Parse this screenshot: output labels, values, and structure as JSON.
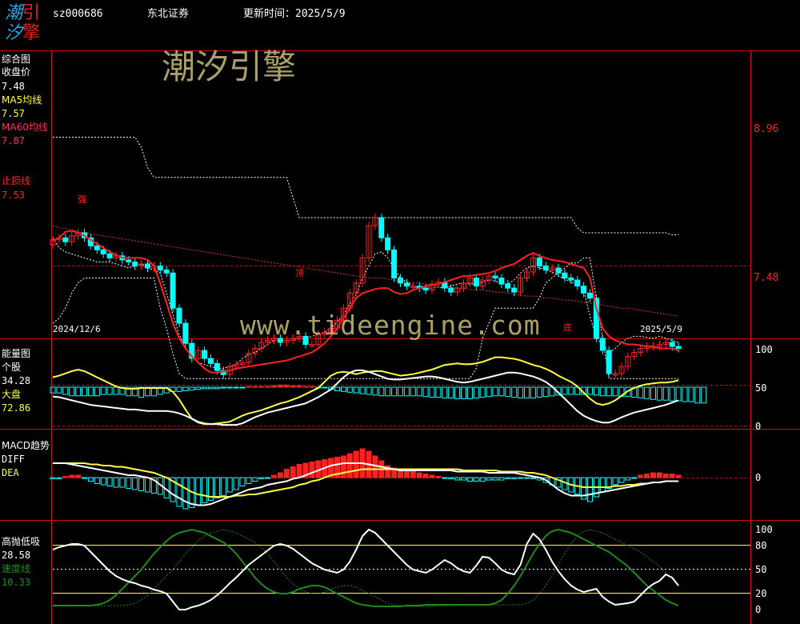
{
  "header": {
    "logo_chars": [
      "潮",
      "引",
      "汐",
      "擎"
    ],
    "code": "sz000686",
    "name": "东北证券",
    "update_label": "更新时间：",
    "update_value": "2025/5/9"
  },
  "watermark": {
    "brand": "潮汐引擎",
    "url": "www.tideengine.com"
  },
  "colors": {
    "up": "#ff2020",
    "down": "#00ffff",
    "ma5": "#ffff40",
    "ma60": "#ff3060",
    "stop": "#ff2020",
    "green": "#1a8c1a",
    "axis": "#d01010"
  },
  "panel1": {
    "labels": {
      "title": "综合图",
      "close_label": "收盘价",
      "close_value": "7.48",
      "ma5_label": "MA5均线",
      "ma5_value": "7.57",
      "ma60_label": "MA60均线",
      "ma60_value": "7.87",
      "stop_label": "止损线",
      "stop_value": "7.53"
    },
    "axis_ticks": [
      "8.96",
      "7.48"
    ],
    "date_start": "2024/12/6",
    "date_end": "2025/5/9",
    "marks": [
      "强",
      "顶",
      "底"
    ]
  },
  "panel2": {
    "labels": {
      "title": "能量图",
      "stock_label": "个股",
      "stock_value": "34.28",
      "market_label": "大盘",
      "market_value": "72.86"
    },
    "axis_ticks": [
      "100",
      "50",
      "0"
    ]
  },
  "panel3": {
    "labels": {
      "title": "MACD趋势",
      "diff_label": "DIFF",
      "dea_label": "DEA"
    },
    "axis_ticks": [
      "0"
    ]
  },
  "panel4": {
    "labels": {
      "title": "高抛低吸",
      "value": "28.58",
      "speed_label": "速度线",
      "speed_value": "10.33"
    },
    "axis_ticks": [
      "100",
      "80",
      "50",
      "20",
      "0"
    ]
  },
  "chart_data": {
    "type": "candlestick",
    "n": 100,
    "close": [
      7.88,
      7.9,
      7.86,
      7.92,
      7.95,
      7.9,
      7.82,
      7.78,
      7.74,
      7.7,
      7.72,
      7.68,
      7.66,
      7.62,
      7.64,
      7.6,
      7.62,
      7.58,
      7.55,
      7.2,
      7.05,
      6.85,
      6.7,
      6.78,
      6.7,
      6.65,
      6.58,
      6.54,
      6.62,
      6.64,
      6.66,
      6.75,
      6.8,
      6.86,
      6.88,
      6.9,
      6.86,
      6.88,
      6.9,
      6.92,
      6.84,
      6.84,
      6.94,
      6.96,
      7.0,
      7.08,
      7.2,
      7.35,
      7.45,
      7.7,
      8.02,
      8.1,
      7.9,
      7.78,
      7.5,
      7.45,
      7.42,
      7.42,
      7.4,
      7.38,
      7.44,
      7.46,
      7.4,
      7.36,
      7.4,
      7.45,
      7.5,
      7.42,
      7.48,
      7.52,
      7.5,
      7.44,
      7.4,
      7.36,
      7.5,
      7.56,
      7.7,
      7.62,
      7.58,
      7.6,
      7.55,
      7.5,
      7.48,
      7.42,
      7.35,
      7.3,
      6.9,
      6.78,
      6.55,
      6.55,
      6.62,
      6.72,
      6.76,
      6.8,
      6.82,
      6.82,
      6.84,
      6.86,
      6.82,
      6.8
    ],
    "ma5": [
      7.9,
      7.8,
      7.76,
      7.74,
      7.72,
      7.7,
      7.68,
      7.66,
      7.66,
      7.66,
      7.64,
      7.62,
      7.6,
      7.62,
      7.64,
      7.6,
      7.58,
      7.55,
      7.35,
      7.14,
      6.94,
      6.8,
      6.72,
      6.66,
      6.64,
      6.62,
      6.6,
      6.6,
      6.62,
      6.64,
      6.7,
      6.74,
      6.76,
      6.8,
      6.84,
      6.88,
      6.88,
      6.88,
      6.88,
      6.9,
      6.9,
      6.92,
      6.94,
      6.96,
      7.0,
      7.06,
      7.14,
      7.24,
      7.34,
      7.5,
      7.62,
      7.74,
      7.76,
      7.7,
      7.6,
      7.5,
      7.46,
      7.42,
      7.4,
      7.4,
      7.4,
      7.41,
      7.4,
      7.42,
      7.44,
      7.45,
      7.44,
      7.44,
      7.46,
      7.48,
      7.47,
      7.45,
      7.44,
      7.48,
      7.55,
      7.6,
      7.62,
      7.6,
      7.58,
      7.56,
      7.52,
      7.49,
      7.46,
      7.44,
      7.38,
      7.12,
      6.9,
      6.84,
      6.76,
      6.8,
      6.86,
      6.9,
      6.92,
      6.92,
      6.91,
      6.9,
      6.92,
      6.9,
      6.88,
      6.86
    ],
    "ma60": [
      8.02,
      8.0,
      7.99,
      7.98,
      7.96,
      7.95,
      7.94,
      7.93,
      7.92,
      7.91,
      7.9,
      7.89,
      7.88,
      7.87,
      7.86,
      7.85,
      7.84,
      7.83,
      7.82,
      7.81,
      7.8,
      7.79,
      7.78,
      7.77,
      7.76,
      7.75,
      7.74,
      7.73,
      7.72,
      7.71,
      7.7,
      7.69,
      7.68,
      7.67,
      7.66,
      7.65,
      7.64,
      7.63,
      7.62,
      7.61,
      7.6,
      7.59,
      7.58,
      7.57,
      7.56,
      7.55,
      7.54,
      7.53,
      7.52,
      7.51,
      7.5,
      7.5,
      7.5,
      7.49,
      7.48,
      7.47,
      7.46,
      7.45,
      7.45,
      7.44,
      7.43,
      7.42,
      7.42,
      7.41,
      7.4,
      7.39,
      7.39,
      7.38,
      7.38,
      7.37,
      7.36,
      7.36,
      7.35,
      7.34,
      7.33,
      7.32,
      7.32,
      7.31,
      7.3,
      7.3,
      7.29,
      7.28,
      7.28,
      7.27,
      7.26,
      7.25,
      7.24,
      7.23,
      7.22,
      7.21,
      7.2,
      7.2,
      7.19,
      7.18,
      7.17,
      7.16,
      7.15,
      7.14,
      7.13,
      7.12
    ],
    "stop": [
      7.87,
      7.9,
      7.96,
      7.97,
      7.95,
      7.92,
      7.88,
      7.84,
      7.8,
      7.76,
      7.73,
      7.7,
      7.7,
      7.7,
      7.7,
      7.68,
      7.62,
      7.45,
      7.25,
      7.05,
      6.9,
      6.8,
      6.72,
      6.66,
      6.6,
      6.56,
      6.56,
      6.57,
      6.58,
      6.6,
      6.61,
      6.62,
      6.63,
      6.64,
      6.65,
      6.66,
      6.67,
      6.68,
      6.7,
      6.72,
      6.74,
      6.76,
      6.8,
      6.85,
      6.92,
      7.0,
      7.1,
      7.2,
      7.3,
      7.35,
      7.37,
      7.39,
      7.4,
      7.4,
      7.36,
      7.34,
      7.35,
      7.38,
      7.4,
      7.42,
      7.43,
      7.44,
      7.46,
      7.48,
      7.5,
      7.52,
      7.52,
      7.53,
      7.54,
      7.55,
      7.57,
      7.6,
      7.62,
      7.64,
      7.68,
      7.72,
      7.75,
      7.72,
      7.7,
      7.68,
      7.67,
      7.66,
      7.64,
      7.62,
      7.6,
      7.5,
      7.2,
      7.0,
      6.92,
      6.88,
      6.86,
      6.84,
      6.84,
      6.83,
      6.82,
      6.82,
      6.8,
      6.8,
      6.8,
      6.78
    ],
    "upper_band": [
      8.9,
      8.9,
      8.9,
      8.9,
      8.9,
      8.9,
      8.9,
      8.9,
      8.9,
      8.9,
      8.9,
      8.9,
      8.9,
      8.9,
      8.8,
      8.6,
      8.5,
      8.5,
      8.5,
      8.5,
      8.5,
      8.5,
      8.5,
      8.5,
      8.5,
      8.5,
      8.5,
      8.5,
      8.5,
      8.5,
      8.5,
      8.5,
      8.5,
      8.5,
      8.5,
      8.5,
      8.5,
      8.5,
      8.3,
      8.1,
      8.1,
      8.1,
      8.1,
      8.1,
      8.1,
      8.1,
      8.1,
      8.1,
      8.1,
      8.1,
      8.1,
      8.1,
      8.1,
      8.1,
      8.1,
      8.1,
      8.1,
      8.1,
      8.1,
      8.1,
      8.1,
      8.1,
      8.1,
      8.1,
      8.1,
      8.1,
      8.1,
      8.1,
      8.1,
      8.1,
      8.1,
      8.1,
      8.1,
      8.1,
      8.1,
      8.1,
      8.1,
      8.1,
      8.1,
      8.1,
      8.1,
      8.1,
      8.1,
      8.0,
      7.95,
      7.95,
      7.95,
      7.95,
      7.95,
      7.95,
      7.95,
      7.95,
      7.95,
      7.95,
      7.95,
      7.95,
      7.95,
      7.95,
      7.93,
      7.93
    ],
    "lower_band": [
      7.05,
      7.1,
      7.2,
      7.35,
      7.45,
      7.5,
      7.5,
      7.5,
      7.5,
      7.5,
      7.5,
      7.5,
      7.5,
      7.5,
      7.5,
      7.5,
      7.5,
      7.2,
      7.0,
      6.75,
      6.55,
      6.5,
      6.5,
      6.5,
      6.5,
      6.5,
      6.5,
      6.5,
      6.5,
      6.5,
      6.5,
      6.5,
      6.5,
      6.5,
      6.5,
      6.5,
      6.5,
      6.5,
      6.5,
      6.5,
      6.5,
      6.5,
      6.5,
      6.5,
      6.5,
      6.5,
      6.5,
      6.5,
      6.5,
      6.5,
      6.5,
      6.5,
      6.5,
      6.5,
      6.5,
      6.5,
      6.5,
      6.5,
      6.5,
      6.5,
      6.5,
      6.5,
      6.5,
      6.5,
      6.5,
      6.5,
      6.5,
      6.6,
      6.9,
      7.05,
      7.2,
      7.2,
      7.2,
      7.2,
      7.2,
      7.2,
      7.2,
      7.3,
      7.45,
      7.5,
      7.55,
      7.6,
      7.65,
      7.65,
      7.7,
      7.7,
      7.3,
      6.9,
      6.5,
      6.5,
      6.5,
      6.5,
      6.5,
      6.5,
      6.5,
      6.5,
      6.5,
      6.5,
      6.5,
      6.5
    ],
    "energy_stock": [
      39,
      38,
      36,
      34,
      32,
      30,
      28,
      27,
      26,
      25,
      24,
      23,
      22,
      22,
      21,
      20,
      20,
      20,
      20,
      19,
      17,
      14,
      10,
      6,
      4,
      3,
      3,
      2,
      2,
      2,
      4,
      8,
      12,
      15,
      18,
      20,
      22,
      24,
      26,
      28,
      30,
      34,
      38,
      43,
      48,
      56,
      64,
      70,
      73,
      73,
      71,
      68,
      65,
      62,
      61,
      61,
      62,
      63,
      64,
      65,
      65,
      64,
      62,
      60,
      58,
      57,
      58,
      60,
      62,
      64,
      66,
      68,
      70,
      70,
      69,
      67,
      65,
      62,
      58,
      52,
      44,
      36,
      28,
      20,
      14,
      10,
      7,
      5,
      5,
      8,
      12,
      15,
      18,
      20,
      22,
      24,
      26,
      28,
      31,
      34
    ],
    "energy_market": [
      64,
      66,
      69,
      72,
      74,
      72,
      68,
      64,
      60,
      56,
      52,
      50,
      49,
      49,
      50,
      50,
      50,
      50,
      50,
      45,
      35,
      22,
      10,
      5,
      3,
      3,
      4,
      5,
      6,
      10,
      14,
      17,
      19,
      21,
      24,
      27,
      30,
      32,
      35,
      38,
      42,
      46,
      50,
      58,
      66,
      70,
      71,
      70,
      68,
      70,
      71,
      72,
      72,
      70,
      68,
      66,
      67,
      68,
      70,
      72,
      74,
      77,
      80,
      81,
      82,
      81,
      81,
      82,
      84,
      87,
      90,
      90,
      89,
      88,
      86,
      83,
      80,
      78,
      75,
      71,
      66,
      62,
      58,
      52,
      44,
      36,
      30,
      28,
      30,
      34,
      40,
      46,
      50,
      53,
      55,
      56,
      57,
      57,
      58,
      60
    ],
    "energy_hist": [
      -8,
      -8,
      -10,
      -12,
      -12,
      -12,
      -12,
      -12,
      -10,
      -10,
      -10,
      -10,
      -12,
      -12,
      -14,
      -12,
      -12,
      -10,
      -8,
      -6,
      -6,
      -5,
      -4,
      -3,
      -2,
      -2,
      -2,
      -1,
      0,
      0,
      0,
      1,
      1,
      1,
      1,
      2,
      3,
      3,
      2,
      2,
      1,
      1,
      0,
      -1,
      -3,
      -5,
      -6,
      -7,
      -8,
      -9,
      -10,
      -11,
      -12,
      -12,
      -12,
      -12,
      -12,
      -12,
      -12,
      -13,
      -14,
      -14,
      -15,
      -15,
      -16,
      -16,
      -16,
      -15,
      -14,
      -13,
      -12,
      -12,
      -13,
      -14,
      -15,
      -15,
      -15,
      -14,
      -13,
      -12,
      -11,
      -10,
      -10,
      -10,
      -10,
      -10,
      -11,
      -12,
      -12,
      -12,
      -13,
      -13,
      -14,
      -15,
      -16,
      -17,
      -18,
      -18,
      -19,
      -19,
      -20,
      -20,
      -22,
      -22
    ],
    "macd_dif": [
      0.12,
      0.12,
      0.12,
      0.11,
      0.1,
      0.09,
      0.08,
      0.07,
      0.06,
      0.05,
      0.04,
      0.03,
      0.02,
      0.02,
      0.01,
      0.0,
      -0.02,
      -0.06,
      -0.1,
      -0.14,
      -0.17,
      -0.2,
      -0.22,
      -0.23,
      -0.23,
      -0.22,
      -0.2,
      -0.18,
      -0.16,
      -0.14,
      -0.12,
      -0.1,
      -0.09,
      -0.08,
      -0.06,
      -0.05,
      -0.04,
      -0.03,
      -0.01,
      0.0,
      0.02,
      0.04,
      0.06,
      0.08,
      0.1,
      0.11,
      0.12,
      0.12,
      0.12,
      0.12,
      0.11,
      0.1,
      0.09,
      0.08,
      0.07,
      0.06,
      0.06,
      0.06,
      0.06,
      0.06,
      0.06,
      0.06,
      0.06,
      0.06,
      0.05,
      0.05,
      0.05,
      0.05,
      0.05,
      0.04,
      0.04,
      0.04,
      0.04,
      0.04,
      0.03,
      0.02,
      0.01,
      0.0,
      -0.02,
      -0.06,
      -0.1,
      -0.13,
      -0.15,
      -0.15,
      -0.15,
      -0.14,
      -0.13,
      -0.12,
      -0.11,
      -0.1,
      -0.09,
      -0.08,
      -0.07,
      -0.06,
      -0.05,
      -0.04,
      -0.04,
      -0.03,
      -0.03,
      -0.03
    ],
    "macd_dea": [
      0.12,
      0.12,
      0.12,
      0.12,
      0.12,
      0.12,
      0.11,
      0.11,
      0.1,
      0.1,
      0.09,
      0.09,
      0.08,
      0.07,
      0.06,
      0.05,
      0.04,
      0.02,
      0.0,
      -0.03,
      -0.06,
      -0.09,
      -0.12,
      -0.14,
      -0.15,
      -0.16,
      -0.16,
      -0.16,
      -0.16,
      -0.15,
      -0.15,
      -0.14,
      -0.14,
      -0.13,
      -0.12,
      -0.11,
      -0.1,
      -0.09,
      -0.08,
      -0.06,
      -0.05,
      -0.03,
      -0.02,
      0.0,
      0.02,
      0.03,
      0.04,
      0.05,
      0.06,
      0.07,
      0.07,
      0.07,
      0.07,
      0.07,
      0.07,
      0.07,
      0.07,
      0.07,
      0.07,
      0.07,
      0.07,
      0.07,
      0.07,
      0.07,
      0.07,
      0.06,
      0.06,
      0.06,
      0.06,
      0.06,
      0.06,
      0.05,
      0.05,
      0.05,
      0.05,
      0.04,
      0.04,
      0.03,
      0.02,
      0.0,
      -0.02,
      -0.04,
      -0.06,
      -0.07,
      -0.08,
      -0.08,
      -0.08,
      -0.08,
      -0.08,
      -0.07,
      -0.07,
      -0.06,
      -0.06,
      -0.05,
      -0.05,
      -0.04,
      -0.04,
      -0.03,
      -0.03,
      -0.03
    ],
    "macd_hist": [
      -0.01,
      -0.01,
      0.01,
      0.02,
      0.02,
      0.0,
      -0.03,
      -0.05,
      -0.06,
      -0.07,
      -0.08,
      -0.08,
      -0.09,
      -0.1,
      -0.11,
      -0.12,
      -0.13,
      -0.14,
      -0.17,
      -0.2,
      -0.24,
      -0.26,
      -0.25,
      -0.23,
      -0.21,
      -0.19,
      -0.17,
      -0.15,
      -0.12,
      -0.1,
      -0.07,
      -0.05,
      -0.03,
      -0.01,
      0.0,
      0.02,
      0.04,
      0.07,
      0.09,
      0.11,
      0.12,
      0.13,
      0.14,
      0.15,
      0.16,
      0.17,
      0.18,
      0.2,
      0.22,
      0.24,
      0.22,
      0.18,
      0.14,
      0.1,
      0.08,
      0.06,
      0.05,
      0.05,
      0.04,
      0.03,
      0.02,
      0.01,
      0.0,
      -0.01,
      -0.02,
      -0.02,
      -0.03,
      -0.03,
      -0.03,
      -0.02,
      -0.02,
      -0.02,
      -0.01,
      -0.01,
      0.0,
      0.0,
      -0.01,
      -0.02,
      -0.04,
      -0.06,
      -0.08,
      -0.1,
      -0.12,
      -0.14,
      -0.18,
      -0.2,
      -0.16,
      -0.12,
      -0.09,
      -0.06,
      -0.04,
      -0.02,
      0.0,
      0.02,
      0.03,
      0.04,
      0.04,
      0.03,
      0.03,
      0.02
    ],
    "hilo_white": [
      75,
      78,
      80,
      82,
      82,
      80,
      72,
      64,
      56,
      48,
      42,
      38,
      35,
      33,
      30,
      28,
      25,
      23,
      20,
      10,
      0,
      0,
      3,
      5,
      8,
      12,
      18,
      25,
      33,
      40,
      48,
      56,
      62,
      68,
      74,
      80,
      82,
      80,
      76,
      70,
      64,
      58,
      54,
      50,
      48,
      46,
      50,
      60,
      75,
      92,
      100,
      96,
      88,
      80,
      72,
      64,
      56,
      50,
      48,
      46,
      50,
      56,
      62,
      58,
      52,
      48,
      46,
      55,
      66,
      65,
      58,
      50,
      46,
      44,
      56,
      82,
      95,
      88,
      75,
      60,
      48,
      38,
      30,
      25,
      22,
      24,
      26,
      16,
      10,
      6,
      7,
      8,
      10,
      18,
      26,
      32,
      36,
      44,
      40,
      30
    ],
    "hilo_green": [
      5,
      5,
      5,
      5,
      5,
      5,
      5,
      6,
      8,
      12,
      18,
      26,
      34,
      42,
      50,
      60,
      70,
      78,
      86,
      92,
      96,
      98,
      100,
      98,
      96,
      92,
      88,
      84,
      78,
      70,
      60,
      50,
      40,
      32,
      26,
      22,
      20,
      20,
      22,
      26,
      28,
      30,
      30,
      28,
      24,
      20,
      16,
      12,
      8,
      6,
      5,
      4,
      4,
      4,
      4,
      4,
      5,
      5,
      5,
      6,
      6,
      6,
      6,
      6,
      6,
      6,
      6,
      6,
      6,
      6,
      8,
      12,
      20,
      30,
      42,
      56,
      70,
      82,
      92,
      98,
      100,
      98,
      96,
      92,
      88,
      84,
      80,
      76,
      72,
      66,
      60,
      54,
      46,
      38,
      30,
      24,
      18,
      12,
      8,
      5
    ],
    "energy_ticks": [
      100,
      50,
      0
    ],
    "hilo_ticks": [
      100,
      80,
      50,
      20,
      0
    ],
    "price_ticks": [
      8.96,
      7.48
    ]
  }
}
